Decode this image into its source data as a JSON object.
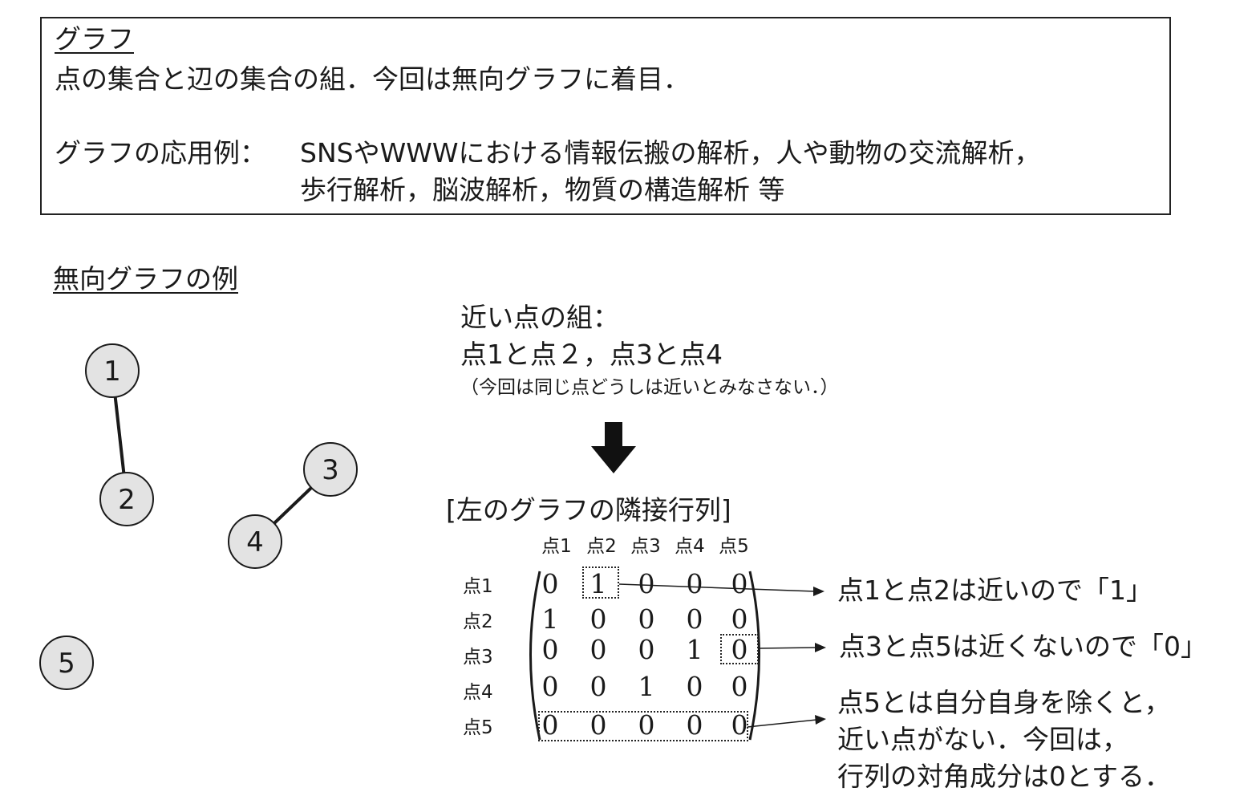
{
  "definition": {
    "heading": "グラフ",
    "line1": "点の集合と辺の集合の組．今回は無向グラフに着目．",
    "applications_label": "グラフの応用例：",
    "applications_line1": "SNSやWWWにおける情報伝搬の解析，人や動物の交流解析，",
    "applications_line2": "歩行解析，脳波解析，物質の構造解析 等"
  },
  "example": {
    "heading": "無向グラフの例",
    "nodes": [
      "1",
      "2",
      "3",
      "4",
      "5"
    ]
  },
  "neighbors": {
    "title": "近い点の組：",
    "pairs": "点1と点２，点3と点4",
    "note": "（今回は同じ点どうしは近いとみなさない．）"
  },
  "matrix": {
    "title": "[左のグラフの隣接行列]",
    "col_headers": [
      "点1",
      "点2",
      "点3",
      "点4",
      "点5"
    ],
    "row_headers": [
      "点1",
      "点2",
      "点3",
      "点4",
      "点5"
    ],
    "rows": [
      [
        "0",
        "1",
        "0",
        "0",
        "0"
      ],
      [
        "1",
        "0",
        "0",
        "0",
        "0"
      ],
      [
        "0",
        "0",
        "0",
        "1",
        "0"
      ],
      [
        "0",
        "0",
        "1",
        "0",
        "0"
      ],
      [
        "0",
        "0",
        "0",
        "0",
        "0"
      ]
    ]
  },
  "annotations": {
    "a1": "点1と点2は近いので「1」",
    "a2": "点3と点5は近くないので「0」",
    "a3_line1": "点5とは自分自身を除くと，",
    "a3_line2": "近い点がない．今回は，",
    "a3_line3": "行列の対角成分は0とする．"
  },
  "colors": {
    "node_fill": "#e3e3e3",
    "stroke": "#1a1a1a"
  }
}
